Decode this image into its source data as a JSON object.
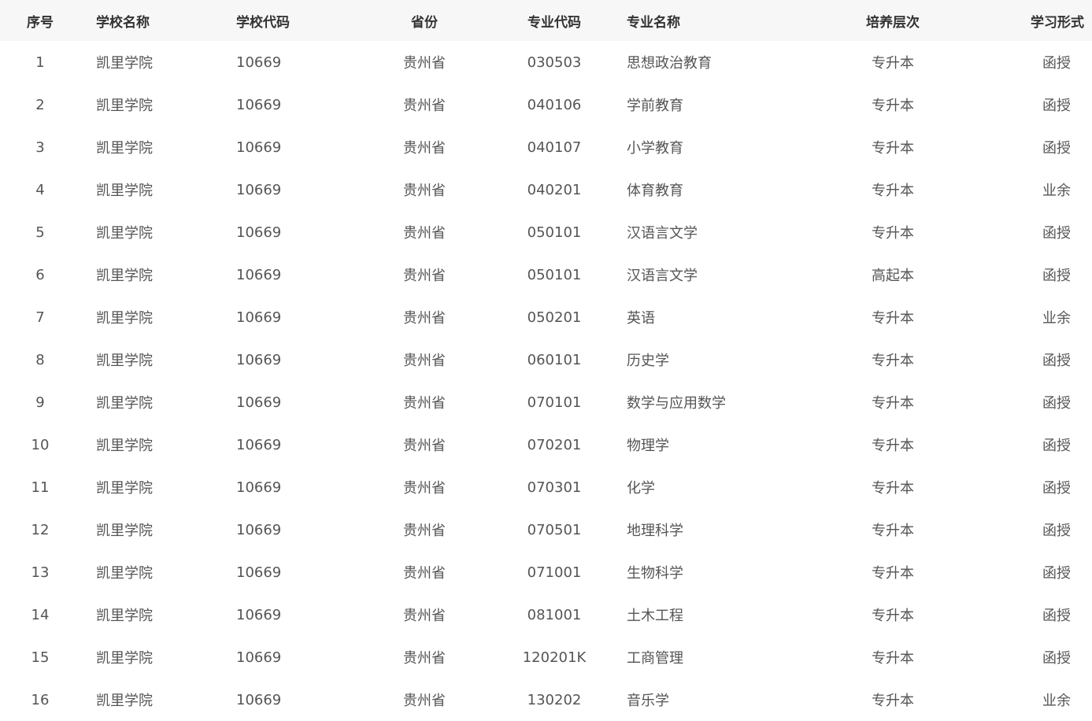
{
  "table": {
    "headers": {
      "index": "序号",
      "school_name": "学校名称",
      "school_code": "学校代码",
      "province": "省份",
      "major_code": "专业代码",
      "major_name": "专业名称",
      "level": "培养层次",
      "study_form": "学习形式"
    },
    "rows": [
      {
        "index": "1",
        "school_name": "凯里学院",
        "school_code": "10669",
        "province": "贵州省",
        "major_code": "030503",
        "major_name": "思想政治教育",
        "level": "专升本",
        "study_form": "函授"
      },
      {
        "index": "2",
        "school_name": "凯里学院",
        "school_code": "10669",
        "province": "贵州省",
        "major_code": "040106",
        "major_name": "学前教育",
        "level": "专升本",
        "study_form": "函授"
      },
      {
        "index": "3",
        "school_name": "凯里学院",
        "school_code": "10669",
        "province": "贵州省",
        "major_code": "040107",
        "major_name": "小学教育",
        "level": "专升本",
        "study_form": "函授"
      },
      {
        "index": "4",
        "school_name": "凯里学院",
        "school_code": "10669",
        "province": "贵州省",
        "major_code": "040201",
        "major_name": "体育教育",
        "level": "专升本",
        "study_form": "业余"
      },
      {
        "index": "5",
        "school_name": "凯里学院",
        "school_code": "10669",
        "province": "贵州省",
        "major_code": "050101",
        "major_name": "汉语言文学",
        "level": "专升本",
        "study_form": "函授"
      },
      {
        "index": "6",
        "school_name": "凯里学院",
        "school_code": "10669",
        "province": "贵州省",
        "major_code": "050101",
        "major_name": "汉语言文学",
        "level": "高起本",
        "study_form": "函授"
      },
      {
        "index": "7",
        "school_name": "凯里学院",
        "school_code": "10669",
        "province": "贵州省",
        "major_code": "050201",
        "major_name": "英语",
        "level": "专升本",
        "study_form": "业余"
      },
      {
        "index": "8",
        "school_name": "凯里学院",
        "school_code": "10669",
        "province": "贵州省",
        "major_code": "060101",
        "major_name": "历史学",
        "level": "专升本",
        "study_form": "函授"
      },
      {
        "index": "9",
        "school_name": "凯里学院",
        "school_code": "10669",
        "province": "贵州省",
        "major_code": "070101",
        "major_name": "数学与应用数学",
        "level": "专升本",
        "study_form": "函授"
      },
      {
        "index": "10",
        "school_name": "凯里学院",
        "school_code": "10669",
        "province": "贵州省",
        "major_code": "070201",
        "major_name": "物理学",
        "level": "专升本",
        "study_form": "函授"
      },
      {
        "index": "11",
        "school_name": "凯里学院",
        "school_code": "10669",
        "province": "贵州省",
        "major_code": "070301",
        "major_name": "化学",
        "level": "专升本",
        "study_form": "函授"
      },
      {
        "index": "12",
        "school_name": "凯里学院",
        "school_code": "10669",
        "province": "贵州省",
        "major_code": "070501",
        "major_name": "地理科学",
        "level": "专升本",
        "study_form": "函授"
      },
      {
        "index": "13",
        "school_name": "凯里学院",
        "school_code": "10669",
        "province": "贵州省",
        "major_code": "071001",
        "major_name": "生物科学",
        "level": "专升本",
        "study_form": "函授"
      },
      {
        "index": "14",
        "school_name": "凯里学院",
        "school_code": "10669",
        "province": "贵州省",
        "major_code": "081001",
        "major_name": "土木工程",
        "level": "专升本",
        "study_form": "函授"
      },
      {
        "index": "15",
        "school_name": "凯里学院",
        "school_code": "10669",
        "province": "贵州省",
        "major_code": "120201K",
        "major_name": "工商管理",
        "level": "专升本",
        "study_form": "函授"
      },
      {
        "index": "16",
        "school_name": "凯里学院",
        "school_code": "10669",
        "province": "贵州省",
        "major_code": "130202",
        "major_name": "音乐学",
        "level": "专升本",
        "study_form": "业余"
      }
    ]
  }
}
